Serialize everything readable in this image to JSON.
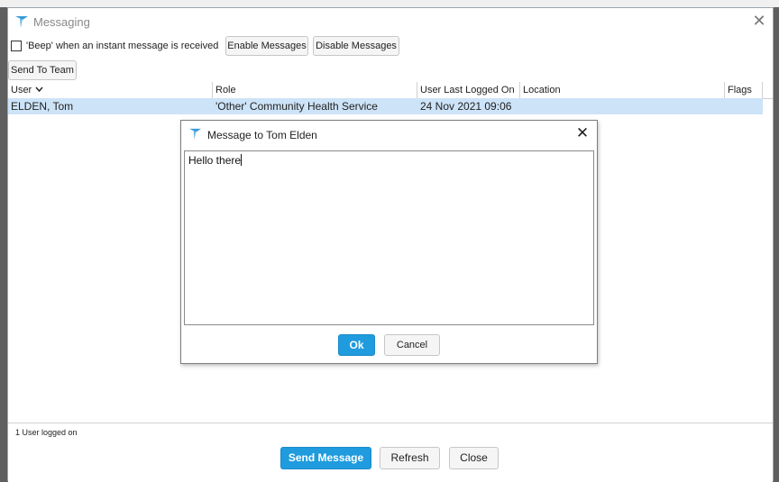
{
  "window": {
    "title": "Messaging",
    "beep_label": "'Beep' when an instant message is received",
    "beep_checked": false,
    "enable_label": "Enable Messages",
    "disable_label": "Disable Messages",
    "send_to_team_label": "Send To Team"
  },
  "table": {
    "columns": [
      "User",
      "Role",
      "User Last Logged On",
      "Location",
      "Flags"
    ],
    "rows": [
      {
        "user": "ELDEN, Tom",
        "role": "'Other' Community Health Service",
        "last_logged_on": "24 Nov 2021 09:06",
        "location": "",
        "flags": ""
      }
    ]
  },
  "status": {
    "text": "1 User logged on"
  },
  "bottom": {
    "send_label": "Send Message",
    "refresh_label": "Refresh",
    "close_label": "Close"
  },
  "dialog": {
    "title": "Message to Tom Elden",
    "message": "Hello there",
    "ok_label": "Ok",
    "cancel_label": "Cancel"
  },
  "colors": {
    "primary": "#1f9bde",
    "selection": "#cde3f8",
    "logo": "#3a9bd8"
  },
  "icons": {
    "app": "app-logo-icon",
    "close": "close-icon",
    "sort": "chevron-down-icon"
  }
}
